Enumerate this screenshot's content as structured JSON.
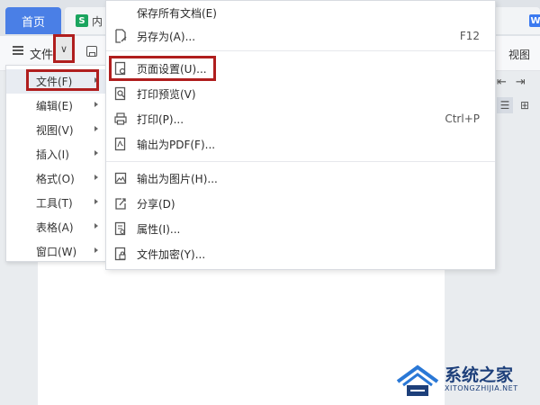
{
  "tabs": {
    "home": "首页",
    "doc_icon": "S",
    "doc_label": "内",
    "right_icon": "W"
  },
  "toolbar": {
    "file_label": "文件",
    "dropdown_glyph": "∨",
    "view_label": "视图"
  },
  "left_menu": {
    "items": [
      {
        "label": "文件(F)"
      },
      {
        "label": "编辑(E)"
      },
      {
        "label": "视图(V)"
      },
      {
        "label": "插入(I)"
      },
      {
        "label": "格式(O)"
      },
      {
        "label": "工具(T)"
      },
      {
        "label": "表格(A)"
      },
      {
        "label": "窗口(W)"
      }
    ]
  },
  "file_menu": {
    "items": [
      {
        "label": "保存所有文档(E)",
        "shortcut": "",
        "icon": "none"
      },
      {
        "label": "另存为(A)...",
        "shortcut": "F12",
        "icon": "save-as-icon"
      },
      {
        "label": "页面设置(U)...",
        "shortcut": "",
        "icon": "page-setup-icon"
      },
      {
        "label": "打印预览(V)",
        "shortcut": "",
        "icon": "print-preview-icon"
      },
      {
        "label": "打印(P)...",
        "shortcut": "Ctrl+P",
        "icon": "printer-icon"
      },
      {
        "label": "输出为PDF(F)...",
        "shortcut": "",
        "icon": "pdf-icon"
      },
      {
        "label": "输出为图片(H)...",
        "shortcut": "",
        "icon": "image-export-icon"
      },
      {
        "label": "分享(D)",
        "shortcut": "",
        "icon": "share-icon"
      },
      {
        "label": "属性(I)...",
        "shortcut": "",
        "icon": "properties-icon"
      },
      {
        "label": "文件加密(Y)...",
        "shortcut": "",
        "icon": "encrypt-file-icon"
      }
    ]
  },
  "watermark": {
    "title": "系统之家",
    "subtitle": "XITONGZHIJIA.NET"
  },
  "colors": {
    "highlight": "#b01e1e",
    "home_tab": "#4a7fe6",
    "watermark": "#1d3f7a"
  }
}
